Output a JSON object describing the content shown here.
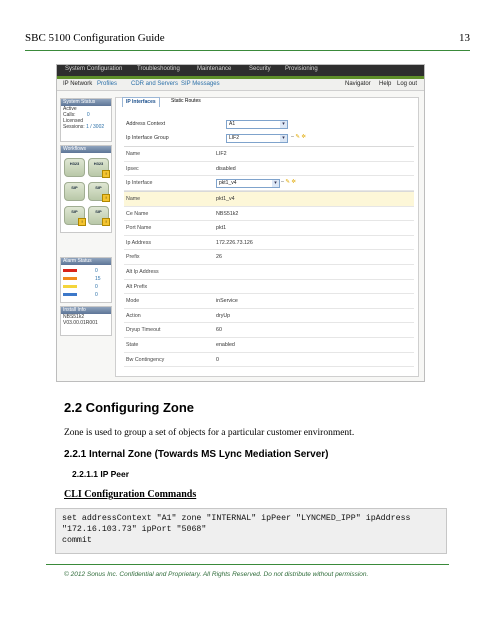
{
  "header": {
    "doc_title": "SBC 5100 Configuration Guide",
    "page_number": "13"
  },
  "screenshot": {
    "top_nav": [
      "System Configuration",
      "Troubleshooting",
      "Maintenance",
      "Security",
      "Provisioning"
    ],
    "sub_nav": [
      "IP Network",
      "Profiles",
      "CDR and Servers",
      "SIP Messages"
    ],
    "right_links": [
      "Navigator",
      "Help",
      "Log out"
    ],
    "system_status": {
      "title": "System Status",
      "lines": [
        "Active",
        "Calls:",
        "Licensed",
        "Sessions:"
      ],
      "calls": "0",
      "sessions": "1 / 3002"
    },
    "workflows": {
      "title": "Workflows",
      "items": [
        "H323",
        "H323",
        "SIP",
        "SIP",
        "SIP",
        "SIP"
      ]
    },
    "alarm_status": {
      "title": "Alarm Status",
      "counts": [
        "0",
        "15",
        "0",
        "0"
      ],
      "colors": [
        "#d9241b",
        "#f08a1d",
        "#f4d53b",
        "#3c78c9"
      ]
    },
    "install_info": {
      "title": "Install Info",
      "lines": [
        "NBS51k2",
        "V03.00.01R001"
      ]
    },
    "tabs": [
      "IP Interfaces",
      "Static Routes"
    ],
    "form": {
      "address_context_label": "Address Context",
      "address_context_value": "A1",
      "ip_interface_group_label": "Ip Interface Group",
      "ip_interface_group_value": "LIF2"
    },
    "group_rows": [
      {
        "k": "Name",
        "v": "LIF2"
      },
      {
        "k": "Ipsec",
        "v": "disabled"
      }
    ],
    "ip_interface_label": "Ip Interface",
    "ip_interface_value": "pkt1_v4",
    "detail_rows": [
      {
        "k": "Name",
        "v": "pkt1_v4"
      },
      {
        "k": "Ce Name",
        "v": "NBS51k2"
      },
      {
        "k": "Port Name",
        "v": "pkt1"
      },
      {
        "k": "Ip Address",
        "v": "172.226.73.126"
      },
      {
        "k": "Prefix",
        "v": "26"
      },
      {
        "k": "Alt Ip Address",
        "v": ""
      },
      {
        "k": "Alt Prefix",
        "v": ""
      },
      {
        "k": "Mode",
        "v": "inService"
      },
      {
        "k": "Action",
        "v": "dryUp"
      },
      {
        "k": "Dryup Timeout",
        "v": "60"
      },
      {
        "k": "State",
        "v": "enabled"
      },
      {
        "k": "Bw Contingency",
        "v": "0"
      }
    ]
  },
  "section": {
    "number_title": "2.2  Configuring Zone",
    "intro": "Zone is used to group a set of objects for a particular customer environment."
  },
  "subsection": {
    "number_title": "2.2.1  Internal Zone (Towards MS Lync Mediation Server)"
  },
  "subsubsection": {
    "number_title": "2.2.1.1  IP Peer"
  },
  "cli_heading": "CLI Configuration Commands",
  "code_lines": [
    "set addressContext \"A1\" zone \"INTERNAL\" ipPeer \"LYNCMED_IPP\" ipAddress",
    "\"172.16.103.73\" ipPort \"5068\"",
    "commit"
  ],
  "footer": "© 2012 Sonus Inc. Confidential and Proprietary. All Rights Reserved. Do not distribute without permission."
}
